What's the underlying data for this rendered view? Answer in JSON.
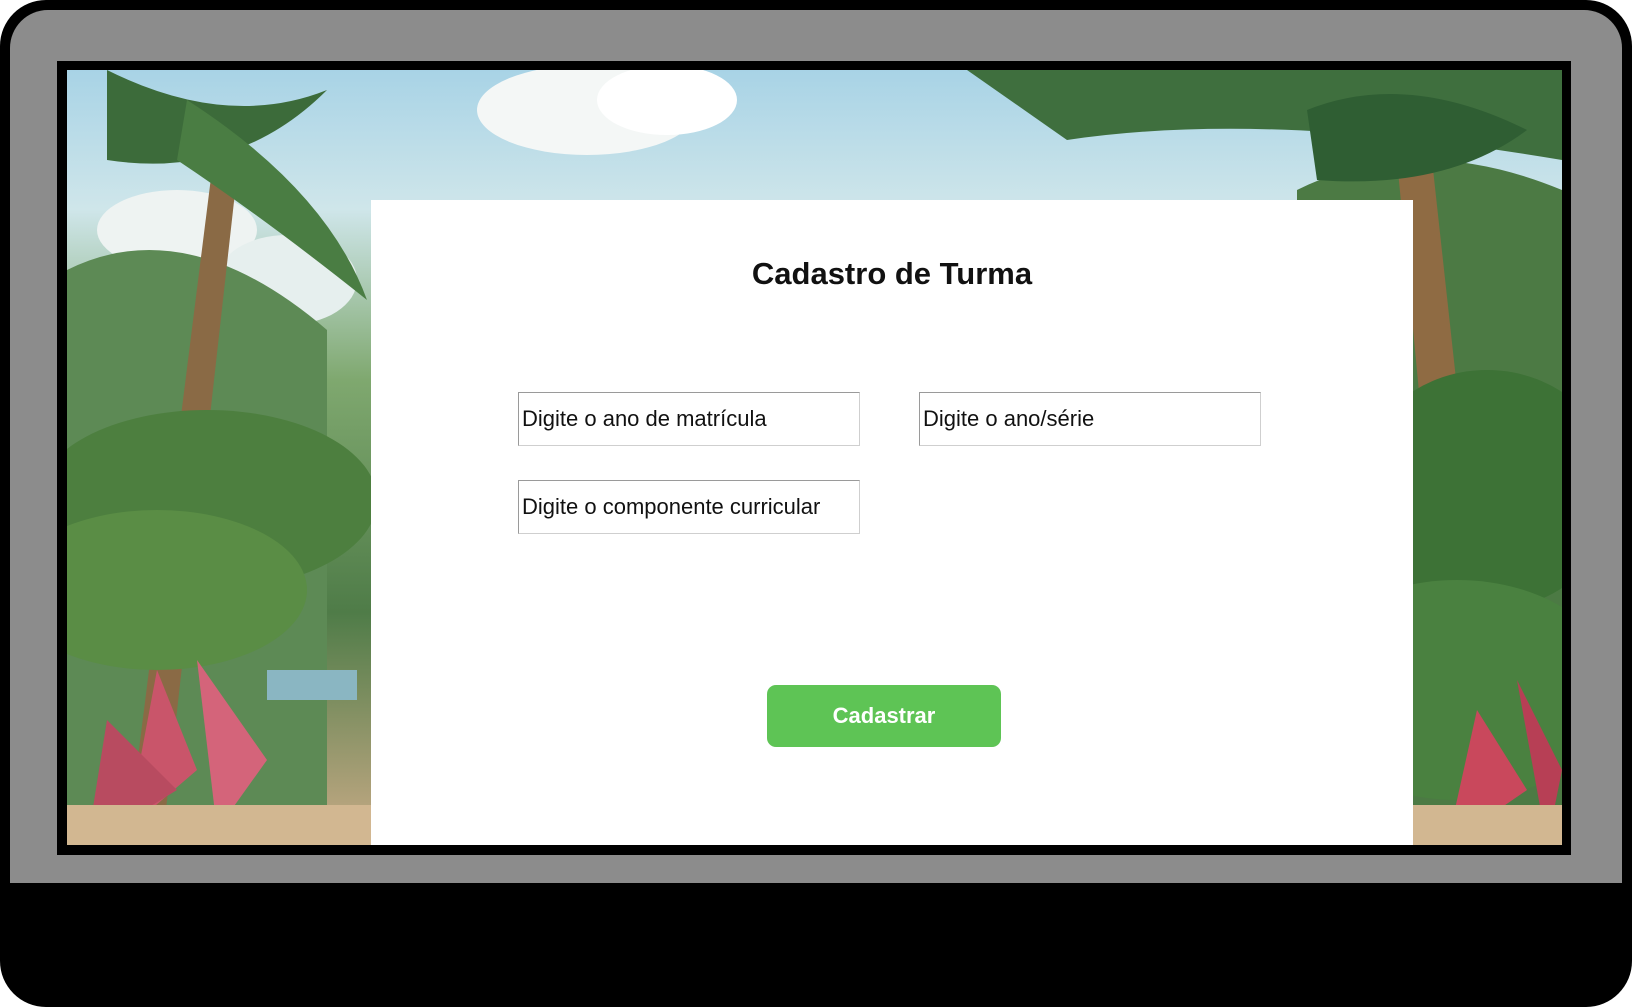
{
  "colors": {
    "device_body": "#000000",
    "bezel": "#8c8c8c",
    "card_background": "#ffffff",
    "button": "#5ec455",
    "button_text": "#ffffff",
    "title_text": "#111111"
  },
  "form": {
    "title": "Cadastro de Turma",
    "fields": {
      "enrollment_year": {
        "value": "",
        "placeholder": "Digite o ano de matrícula"
      },
      "grade": {
        "value": "",
        "placeholder": "Digite o ano/série"
      },
      "curricular_component": {
        "value": "",
        "placeholder": "Digite o componente curricular"
      }
    },
    "submit_label": "Cadastrar"
  }
}
